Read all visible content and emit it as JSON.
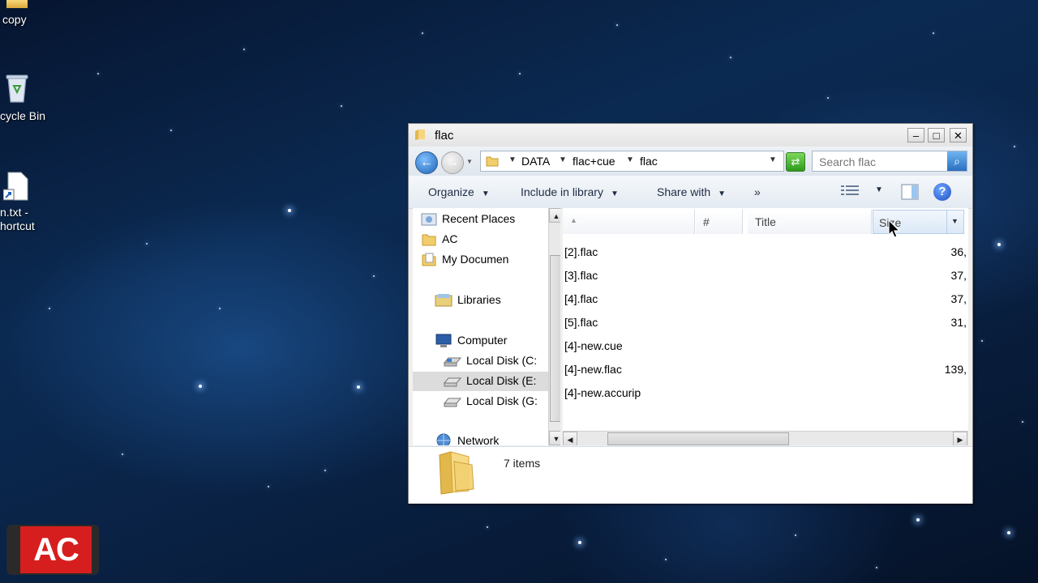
{
  "desktop": {
    "icons": [
      {
        "label": "copy"
      },
      {
        "label": "cycle Bin"
      },
      {
        "label_line1": "n.txt -",
        "label_line2": "hortcut"
      }
    ],
    "logo_text": "AC"
  },
  "window": {
    "title": "flac",
    "minimize": "–",
    "maximize": "□",
    "close": "✕"
  },
  "address": {
    "breadcrumbs": [
      "DATA",
      "flac+cue",
      "flac"
    ],
    "search_placeholder": "Search flac"
  },
  "toolbar": {
    "organize": "Organize",
    "include_in_library": "Include in library",
    "share_with": "Share with",
    "more": "»",
    "help": "?"
  },
  "nav_pane": {
    "items": [
      {
        "label": "Recent Places",
        "icon": "recent-places-icon"
      },
      {
        "label": "AC",
        "icon": "folder-icon"
      },
      {
        "label": "My Documen",
        "icon": "documents-icon"
      },
      {
        "label": "Libraries",
        "icon": "libraries-icon"
      },
      {
        "label": "Computer",
        "icon": "computer-icon"
      },
      {
        "label": "Local Disk (C:",
        "icon": "disk-icon"
      },
      {
        "label": "Local Disk (E:",
        "icon": "disk-icon",
        "selected": true
      },
      {
        "label": "Local Disk (G:",
        "icon": "disk-icon"
      },
      {
        "label": "Network",
        "icon": "network-icon"
      }
    ]
  },
  "file_list": {
    "columns": [
      "",
      "#",
      "Title",
      "Size"
    ],
    "rows": [
      {
        "name": "[2].flac",
        "size": "36,"
      },
      {
        "name": "[3].flac",
        "size": "37,"
      },
      {
        "name": "[4].flac",
        "size": "37,"
      },
      {
        "name": "[5].flac",
        "size": "31,"
      },
      {
        "name": "[4]-new.cue",
        "size": ""
      },
      {
        "name": "[4]-new.flac",
        "size": "139,"
      },
      {
        "name": "[4]-new.accurip",
        "size": ""
      }
    ]
  },
  "details_pane": {
    "item_count": "7 items"
  },
  "colors": {
    "accent_blue": "#1f62b5",
    "logo_red": "#d71e1e"
  }
}
